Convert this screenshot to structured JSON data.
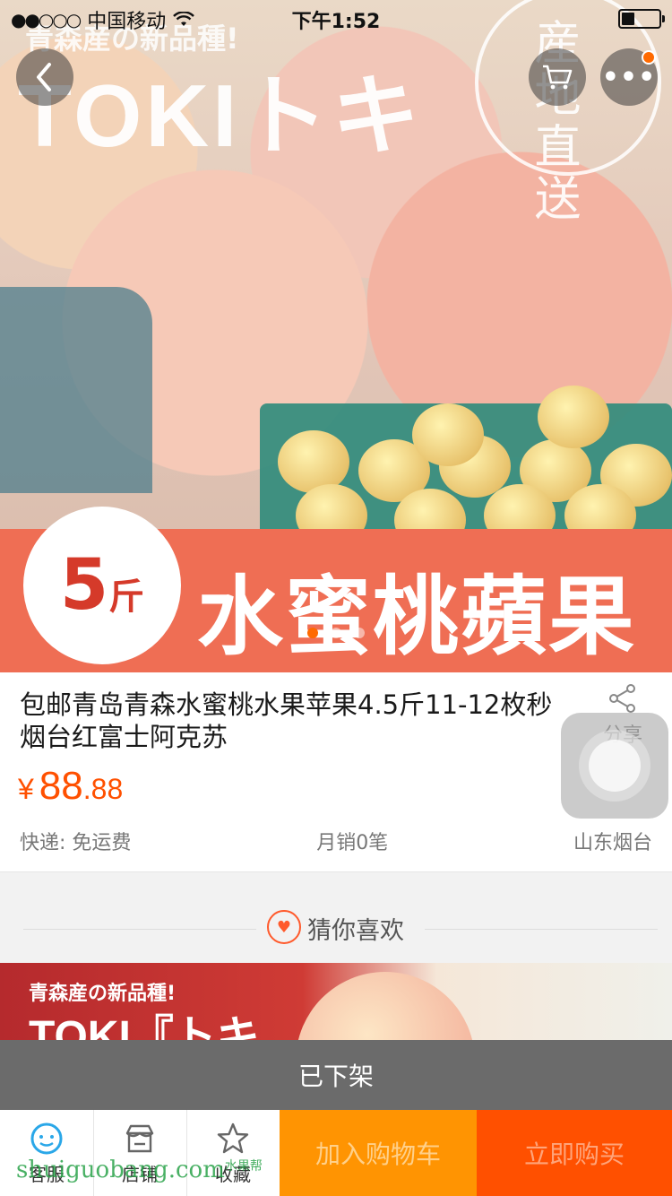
{
  "status_bar": {
    "carrier": "中国移动",
    "signal": "●●○○○",
    "time": "下午1:52"
  },
  "hero": {
    "subtitle_jp": "青森産の新品種!",
    "title_en": "TOKIトキ",
    "stamp_text": "産地直送",
    "weight_number": "5",
    "weight_unit": "斤",
    "banner_text": "水蜜桃蘋果",
    "slide_count": 3,
    "active_slide": 1
  },
  "nav": {
    "back_icon": "chevron-left-icon",
    "cart_icon": "cart-icon",
    "more_icon": "more-icon",
    "more_glyph": "•••"
  },
  "product": {
    "title": "包邮青岛青森水蜜桃水果苹果4.5斤11-12枚秒烟台红富士阿克苏",
    "share_label": "分享",
    "price_currency": "¥",
    "price_integer": "88",
    "price_decimal": ".88",
    "shipping": "快递: 免运费",
    "monthly_sales": "月销0笔",
    "location": "山东烟台"
  },
  "recommend": {
    "label": "猜你喜欢",
    "image_jp": "青森産の新品種!",
    "image_en": "TOKI『トキ"
  },
  "offshelf_text": "已下架",
  "bottom_bar": {
    "service_label": "客服",
    "shop_label": "店铺",
    "favorite_label": "收藏",
    "add_to_cart": "加入购物车",
    "buy_now": "立即购买"
  },
  "watermark": {
    "text": "shuiguobang.com",
    "small": "水果帮"
  },
  "colors": {
    "accent": "#ff5000",
    "cart_button": "#ff9402",
    "offshelf_bg": "#6b6b6b"
  }
}
